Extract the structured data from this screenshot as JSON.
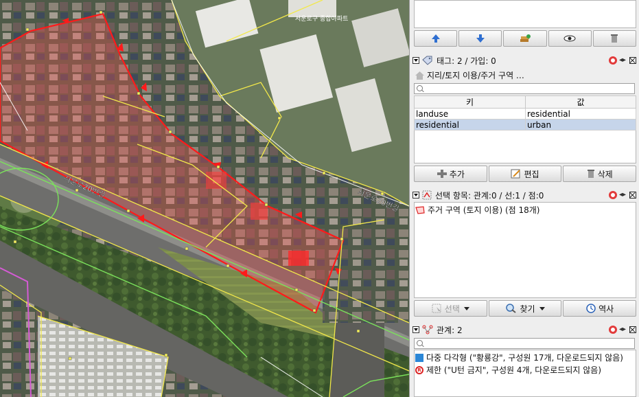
{
  "map": {
    "road_label_1": "서운로20번길",
    "road_label_2": "서운로20번길",
    "road_label_3": "서운로구 종합아파트"
  },
  "top_toolbar": {
    "buttons": [
      "move-up",
      "move-down",
      "layer-stack",
      "visibility",
      "delete"
    ]
  },
  "tags": {
    "header": "태그: 2 / 가입: 0",
    "preset": "지리/토지 이용/주거 구역 …",
    "search_placeholder": "",
    "col_key": "키",
    "col_value": "값",
    "rows": [
      {
        "key": "landuse",
        "value": "residential"
      },
      {
        "key": "residential",
        "value": "urban"
      }
    ],
    "add_label": "추가",
    "edit_label": "편집",
    "delete_label": "삭제"
  },
  "selection": {
    "header": "선택 항목: 관계:0 / 선:1 / 점:0",
    "item": "주거 구역 (토지 이용) (점 18개)",
    "select_label": "선택",
    "find_label": "찾기",
    "history_label": "역사"
  },
  "relations": {
    "header": "관계: 2",
    "items": [
      {
        "icon": "multipolygon-icon",
        "text": "다중 다각형 (\"황룡강\", 구성원 17개, 다운로드되지 않음)"
      },
      {
        "icon": "no-u-turn-icon",
        "text": "제한 (\"U턴 금지\", 구성원 4개, 다운로드되지 않음)"
      }
    ]
  },
  "colors": {
    "selection_red": "#ff1a1a",
    "landuse_fill": "#ff5050",
    "way_yellow": "#f2e84a",
    "way_green": "#7be35b",
    "row_selected": "#c6d5ea"
  }
}
